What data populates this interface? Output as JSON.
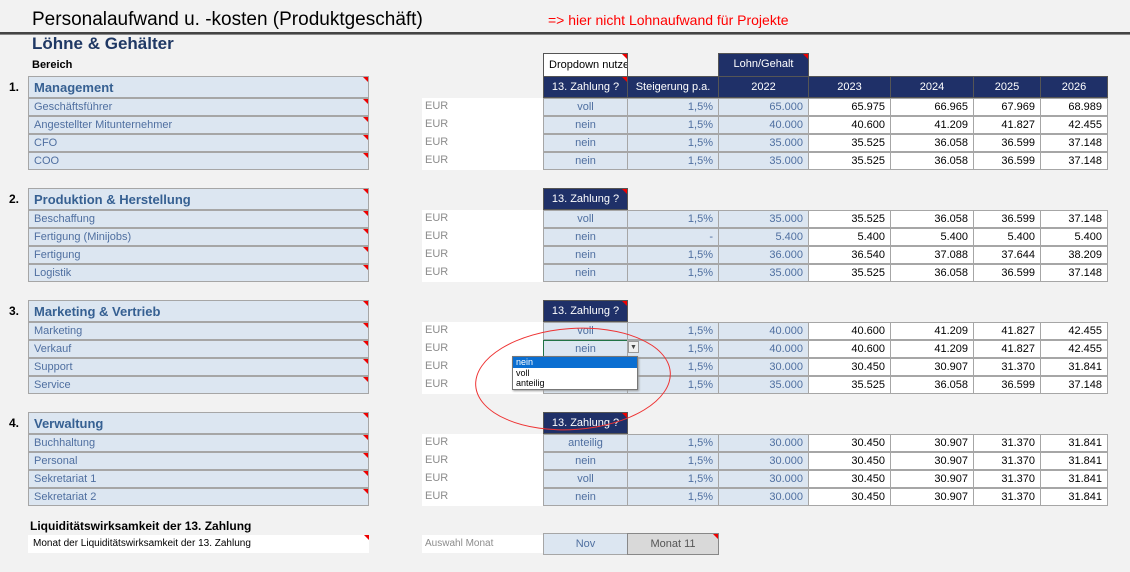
{
  "title": "Personalaufwand u. -kosten  (Produktgeschäft)",
  "note": "=> hier nicht Lohnaufwand für Projekte",
  "subtitle": "Löhne & Gehälter",
  "bereich_label": "Bereich",
  "dropdown_hint": "Dropdown nutzen",
  "lohn_label": "Lohn/Gehalt",
  "headers": {
    "zahlung": "13. Zahlung ?",
    "steigerung": "Steigerung p.a.",
    "years": [
      "2022",
      "2023",
      "2024",
      "2025",
      "2026"
    ]
  },
  "sections": [
    {
      "num": "1.",
      "name": "Management",
      "rows": [
        {
          "label": "Geschäftsführer",
          "unit": "EUR",
          "zahlung": "voll",
          "steigerung": "1,5%",
          "values": [
            "65.000",
            "65.975",
            "66.965",
            "67.969",
            "68.989"
          ]
        },
        {
          "label": "Angestellter Mitunternehmer",
          "unit": "EUR",
          "zahlung": "nein",
          "steigerung": "1,5%",
          "values": [
            "40.000",
            "40.600",
            "41.209",
            "41.827",
            "42.455"
          ]
        },
        {
          "label": "CFO",
          "unit": "EUR",
          "zahlung": "nein",
          "steigerung": "1,5%",
          "values": [
            "35.000",
            "35.525",
            "36.058",
            "36.599",
            "37.148"
          ]
        },
        {
          "label": "COO",
          "unit": "EUR",
          "zahlung": "nein",
          "steigerung": "1,5%",
          "values": [
            "35.000",
            "35.525",
            "36.058",
            "36.599",
            "37.148"
          ]
        }
      ]
    },
    {
      "num": "2.",
      "name": "Produktion & Herstellung",
      "rows": [
        {
          "label": "Beschaffung",
          "unit": "EUR",
          "zahlung": "voll",
          "steigerung": "1,5%",
          "values": [
            "35.000",
            "35.525",
            "36.058",
            "36.599",
            "37.148"
          ]
        },
        {
          "label": "Fertigung (Minijobs)",
          "unit": "EUR",
          "zahlung": "nein",
          "steigerung": "-",
          "values": [
            "5.400",
            "5.400",
            "5.400",
            "5.400",
            "5.400"
          ]
        },
        {
          "label": "Fertigung",
          "unit": "EUR",
          "zahlung": "nein",
          "steigerung": "1,5%",
          "values": [
            "36.000",
            "36.540",
            "37.088",
            "37.644",
            "38.209"
          ]
        },
        {
          "label": "Logistik",
          "unit": "EUR",
          "zahlung": "nein",
          "steigerung": "1,5%",
          "values": [
            "35.000",
            "35.525",
            "36.058",
            "36.599",
            "37.148"
          ]
        }
      ]
    },
    {
      "num": "3.",
      "name": "Marketing & Vertrieb",
      "rows": [
        {
          "label": "Marketing",
          "unit": "EUR",
          "zahlung": "voll",
          "steigerung": "1,5%",
          "values": [
            "40.000",
            "40.600",
            "41.209",
            "41.827",
            "42.455"
          ]
        },
        {
          "label": "Verkauf",
          "unit": "EUR",
          "zahlung": "nein",
          "steigerung": "1,5%",
          "values": [
            "40.000",
            "40.600",
            "41.209",
            "41.827",
            "42.455"
          ]
        },
        {
          "label": "Support",
          "unit": "EUR",
          "zahlung": "",
          "steigerung": "1,5%",
          "values": [
            "30.000",
            "30.450",
            "30.907",
            "31.370",
            "31.841"
          ]
        },
        {
          "label": "Service",
          "unit": "EUR",
          "zahlung": "",
          "steigerung": "1,5%",
          "values": [
            "35.000",
            "35.525",
            "36.058",
            "36.599",
            "37.148"
          ]
        }
      ]
    },
    {
      "num": "4.",
      "name": "Verwaltung",
      "rows": [
        {
          "label": "Buchhaltung",
          "unit": "EUR",
          "zahlung": "anteilig",
          "steigerung": "1,5%",
          "values": [
            "30.000",
            "30.450",
            "30.907",
            "31.370",
            "31.841"
          ]
        },
        {
          "label": "Personal",
          "unit": "EUR",
          "zahlung": "nein",
          "steigerung": "1,5%",
          "values": [
            "30.000",
            "30.450",
            "30.907",
            "31.370",
            "31.841"
          ]
        },
        {
          "label": "Sekretariat 1",
          "unit": "EUR",
          "zahlung": "voll",
          "steigerung": "1,5%",
          "values": [
            "30.000",
            "30.450",
            "30.907",
            "31.370",
            "31.841"
          ]
        },
        {
          "label": "Sekretariat 2",
          "unit": "EUR",
          "zahlung": "nein",
          "steigerung": "1,5%",
          "values": [
            "30.000",
            "30.450",
            "30.907",
            "31.370",
            "31.841"
          ]
        }
      ]
    }
  ],
  "dropdown": {
    "options": [
      "nein",
      "voll",
      "anteilig"
    ],
    "selected": "nein"
  },
  "liquidity": {
    "heading": "Liquiditätswirksamkeit der 13. Zahlung",
    "label": "Monat der Liquiditätswirksamkeit der 13. Zahlung",
    "select_label": "Auswahl Monat",
    "month": "Nov",
    "month_num": "Monat 11"
  },
  "colors": {
    "header": "#1f3068",
    "input": "#dce6f1",
    "note": "#ff0000",
    "annotation": "#e33333"
  }
}
